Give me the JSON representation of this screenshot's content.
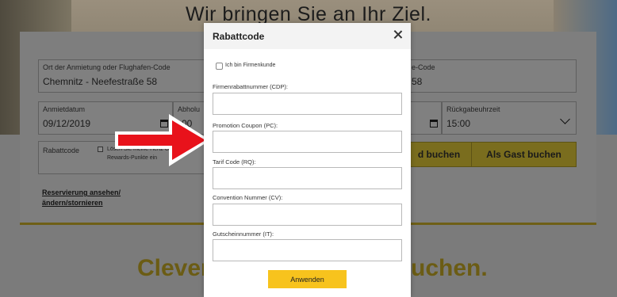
{
  "background": {
    "hero_title": "Wir bringen Sie an Ihr Ziel.",
    "pickup_location": {
      "label": "Ort der Anmietung oder Flughafen-Code",
      "value": "Chemnitz - Neefestraße 58"
    },
    "return_location": {
      "label_partial": "e-Code",
      "value_partial": "58"
    },
    "pickup_date": {
      "label": "Anmietdatum",
      "value": "09/12/2019"
    },
    "pickup_time": {
      "label_partial": "Abholu",
      "value_partial": "00"
    },
    "return_time": {
      "label": "Rückgabeuhrzeit",
      "value": "15:00"
    },
    "rabattcode": {
      "label": "Rabattcode",
      "checkbox_text_line1": "Lösen Sie meine Hertz Gold",
      "checkbox_text_line2": "Rewards-Punkte ein"
    },
    "book_button_partial": "d buchen",
    "guest_button": "Als Gast buchen",
    "manage_link_line1": "Reservierung ansehen/",
    "manage_link_line2": "ändern/stornieren",
    "slogan_left": "Clever",
    "slogan_right": "uchen."
  },
  "modal": {
    "title": "Rabattcode",
    "firmenkunde_label": "Ich bin Firmenkunde",
    "fields": [
      {
        "label": "Firmenrabattnummer (CDP):",
        "value": ""
      },
      {
        "label": "Promotion Coupon (PC):",
        "value": ""
      },
      {
        "label": "Tarif Code (RQ):",
        "value": ""
      },
      {
        "label": "Convention Nummer (CV):",
        "value": ""
      },
      {
        "label": "Gutscheinnummer (IT):",
        "value": ""
      }
    ],
    "apply_button": "Anwenden"
  },
  "colors": {
    "accent": "#f7c31d",
    "annotation_arrow": "#e8121b"
  }
}
